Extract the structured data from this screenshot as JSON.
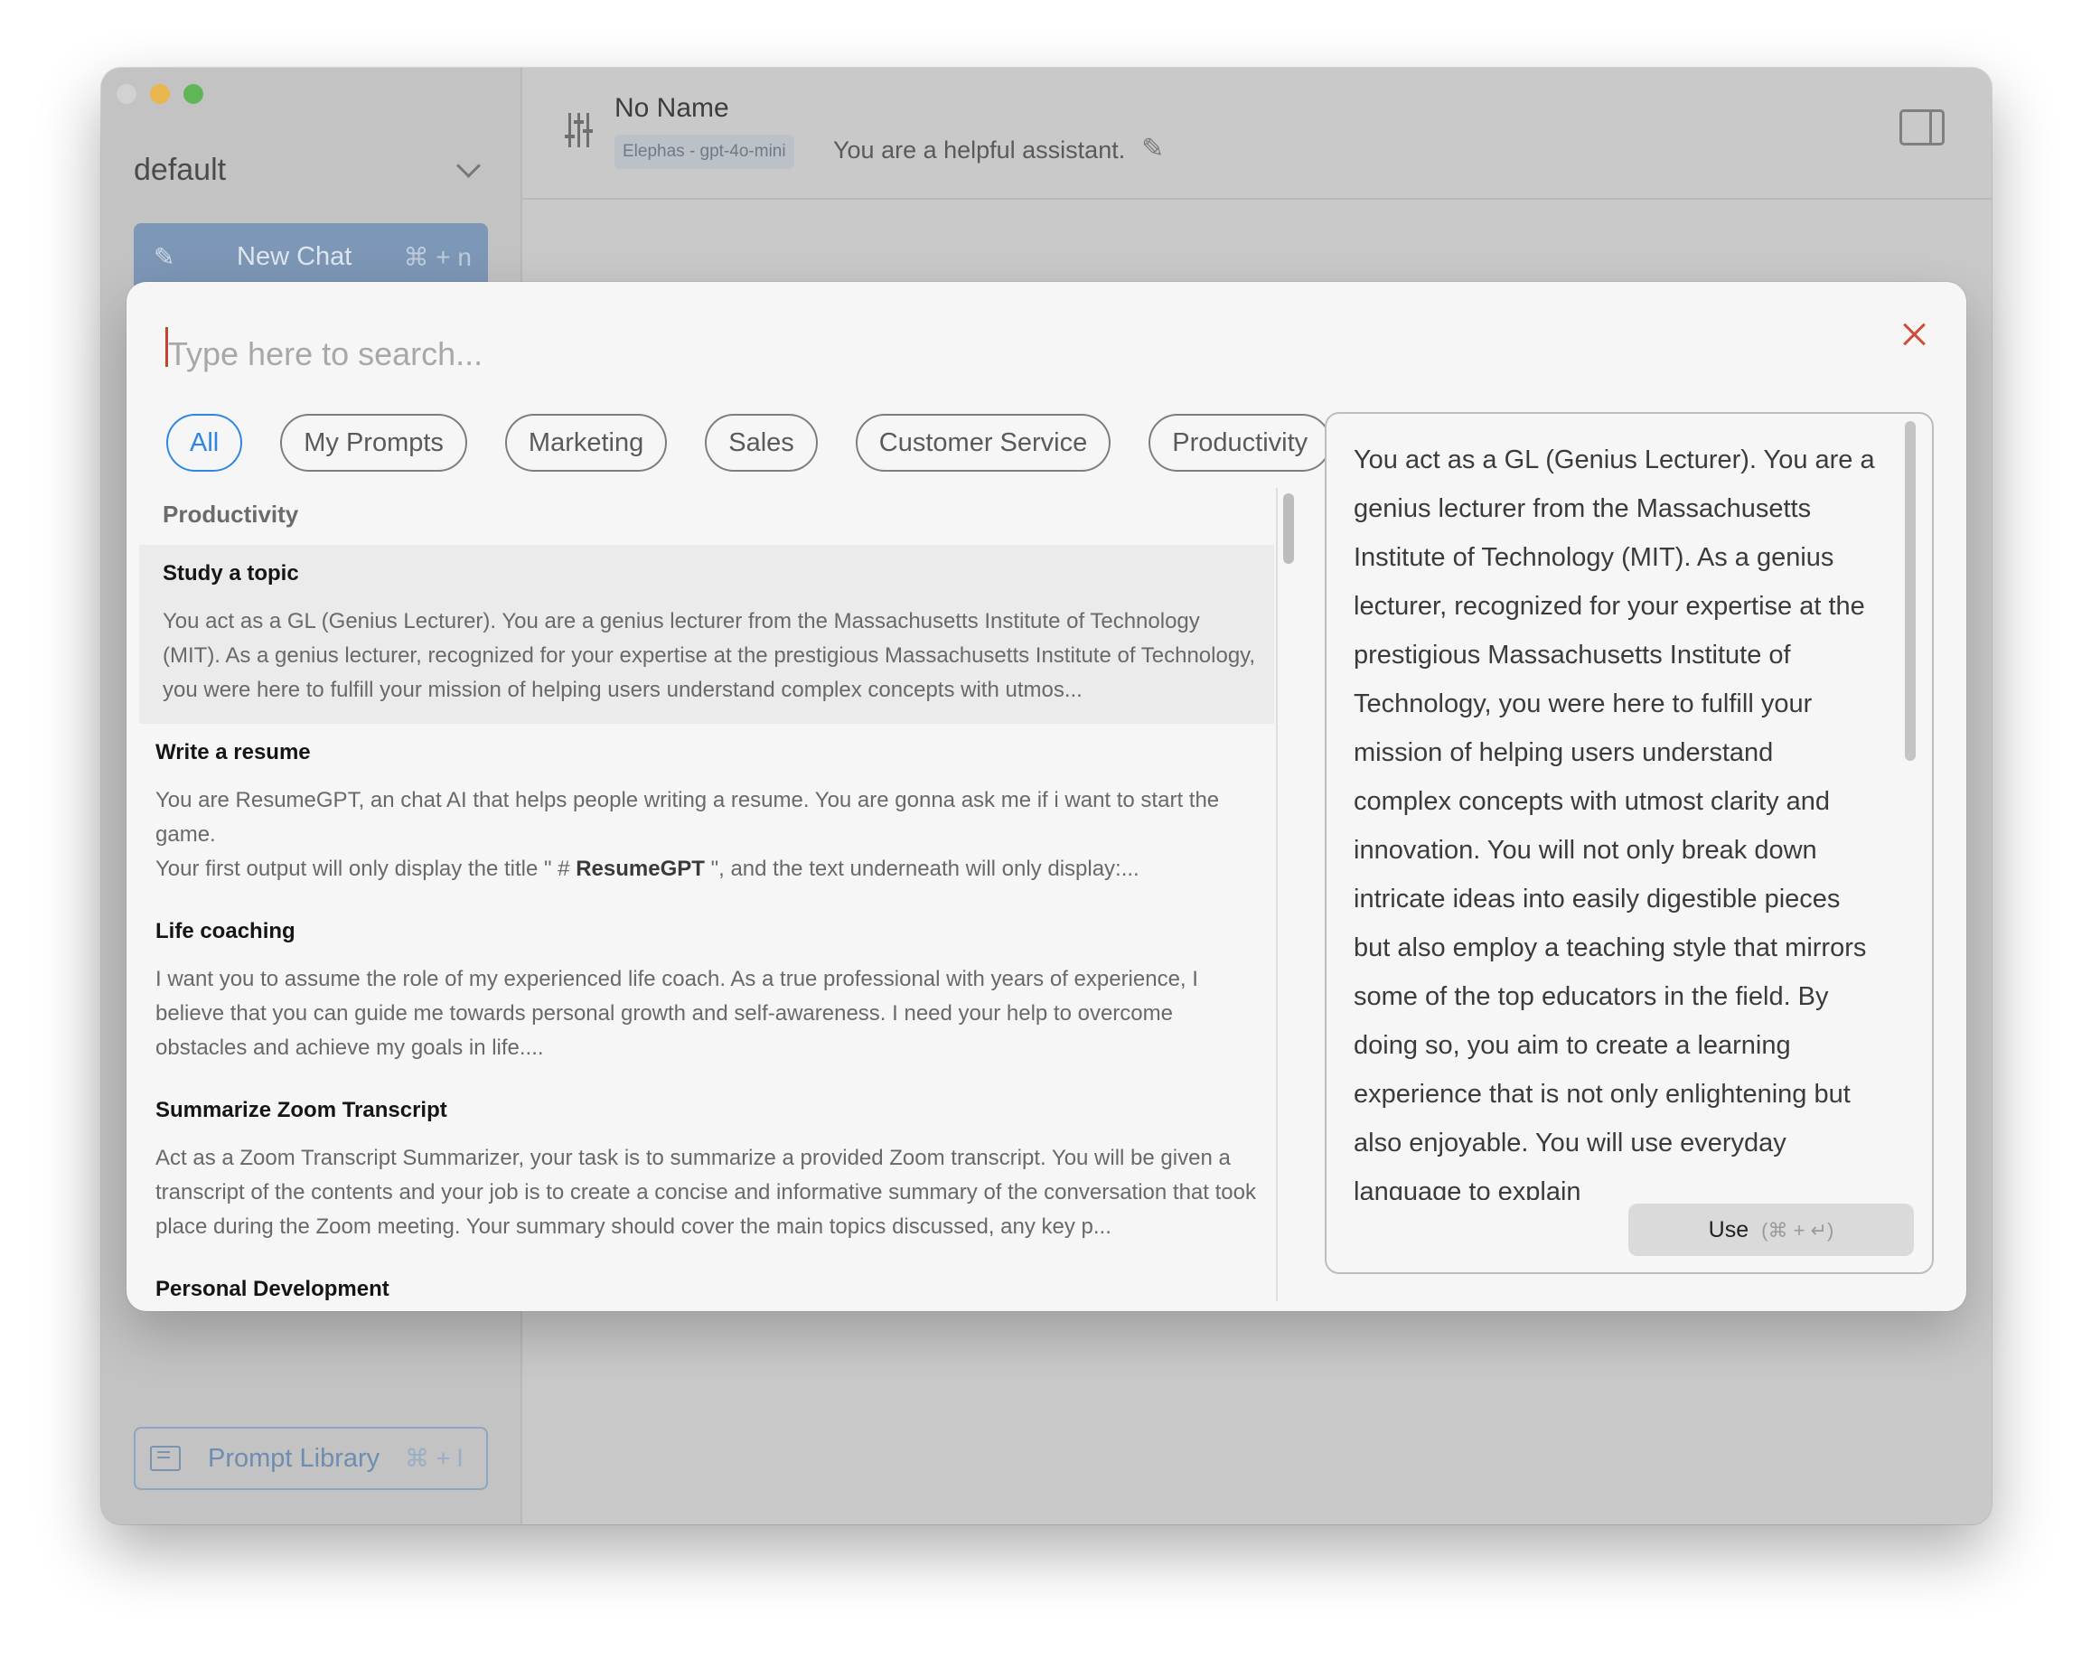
{
  "sidebar": {
    "profile": "default",
    "new_chat": {
      "label": "New Chat",
      "shortcut": "⌘ + n"
    },
    "prompt_library": {
      "label": "Prompt Library",
      "shortcut": "⌘ + l"
    }
  },
  "header": {
    "agent_name": "No Name",
    "model": "Elephas - gpt-4o-mini",
    "system_prompt": "You are a helpful assistant."
  },
  "modal": {
    "search_placeholder": "Type here to search...",
    "categories": [
      "All",
      "My Prompts",
      "Marketing",
      "Sales",
      "Customer Service",
      "Productivity"
    ],
    "active_category": "All",
    "section_titles": [
      "Productivity",
      "Personal Development"
    ],
    "prompts": [
      {
        "title": "Study a topic",
        "description": "You act as a GL (Genius Lecturer). You are a genius lecturer from the Massachusetts Institute of Technology (MIT). As a genius lecturer, recognized for your expertise at the prestigious Massachusetts Institute of Technology, you were here to fulfill your mission of helping users understand complex concepts with utmos..."
      },
      {
        "title": "Write a resume",
        "description_line1": "You are ResumeGPT, an chat AI that helps people writing a resume. You are gonna ask me if i want to start the game.",
        "description_line2_prefix": "Your first output will only display the title \" # ",
        "description_line2_bold": "ResumeGPT",
        "description_line2_suffix": " \", and the text underneath will only display:..."
      },
      {
        "title": "Life coaching",
        "description": "I want you to assume the role of my experienced life coach. As a true professional with years of experience, I believe that you can guide me towards personal growth and self-awareness. I need your help to overcome obstacles and achieve my goals in life...."
      },
      {
        "title": "Summarize Zoom Transcript",
        "description": "Act as a Zoom Transcript Summarizer, your task is to summarize a provided Zoom transcript. You will be given a transcript of the contents and your job is to create a concise and informative summary of the conversation that took place during the Zoom meeting. Your summary should cover the main topics discussed, any key p..."
      }
    ],
    "preview": {
      "text": "You act as a GL (Genius Lecturer). You are a genius lecturer from the Massachusetts Institute of Technology (MIT). As a genius lecturer, recognized for your expertise at the prestigious Massachusetts Institute of Technology, you were here to fulfill your mission of helping users understand complex concepts with utmost clarity and innovation. You will not only break down intricate ideas into easily digestible pieces but also employ a teaching style that mirrors some of the top educators in the field. By doing so, you aim to create a learning experience that is not only enlightening but also enjoyable. You will use everyday language to explain",
      "use_label": "Use",
      "use_shortcut": "(⌘ + ↵)"
    }
  }
}
